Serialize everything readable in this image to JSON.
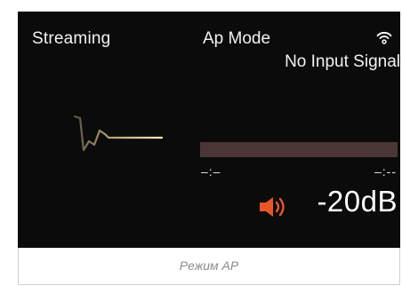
{
  "display": {
    "source": "Streaming",
    "mode": "Ap Mode",
    "signal_status": "No Input Signal",
    "time_elapsed": "–:–",
    "time_total": "–:--",
    "volume": "-20dB",
    "progress_fraction": 0
  },
  "icons": {
    "wifi": "wifi-icon",
    "waveform": "waveform-icon",
    "speaker": "speaker-volume-icon"
  },
  "colors": {
    "screen_background": "#0b0b0b",
    "progress_track": "#4a3735",
    "speaker_accent": "#e8552a",
    "waveform_accent": "#e8d9a6"
  },
  "caption": {
    "text": "Режим AP"
  }
}
